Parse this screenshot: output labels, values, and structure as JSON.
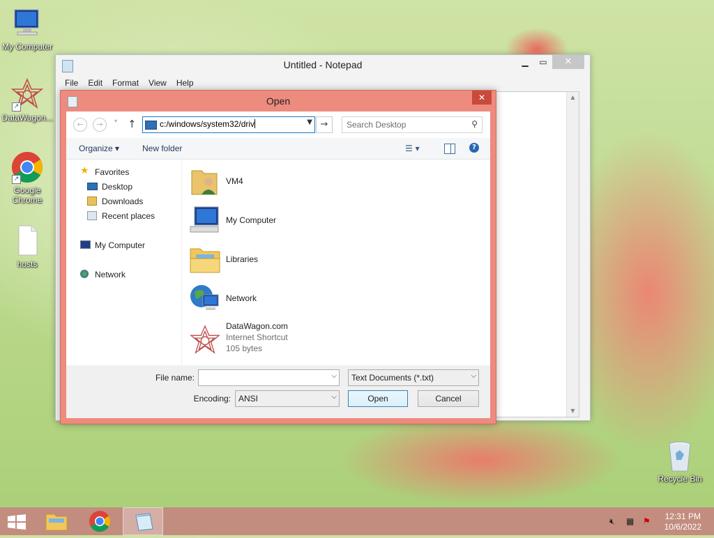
{
  "desktop": {
    "icons": [
      {
        "label": "My Computer"
      },
      {
        "label": "DataWagon..."
      },
      {
        "label": "Google Chrome"
      },
      {
        "label": "hosts"
      },
      {
        "label": "Recycle Bin"
      }
    ]
  },
  "notepad": {
    "title": "Untitled - Notepad",
    "menu": [
      "File",
      "Edit",
      "Format",
      "View",
      "Help"
    ]
  },
  "dialog": {
    "title": "Open",
    "address": "c:/windows/system32/driv",
    "search_placeholder": "Search Desktop",
    "toolbar": {
      "organize": "Organize",
      "new_folder": "New folder",
      "help": "?"
    },
    "nav": {
      "favorites": "Favorites",
      "desktop": "Desktop",
      "downloads": "Downloads",
      "recent": "Recent places",
      "my_computer": "My Computer",
      "network": "Network"
    },
    "files": [
      {
        "name": "VM4"
      },
      {
        "name": "My Computer"
      },
      {
        "name": "Libraries"
      },
      {
        "name": "Network"
      },
      {
        "name": "DataWagon.com",
        "type": "Internet Shortcut",
        "size": "105 bytes"
      }
    ],
    "file_name_label": "File name:",
    "file_name_value": "",
    "file_type": "Text Documents (*.txt)",
    "encoding_label": "Encoding:",
    "encoding": "ANSI",
    "open_button": "Open",
    "cancel_button": "Cancel"
  },
  "taskbar": {
    "time": "12:31 PM",
    "date": "10/6/2022"
  }
}
